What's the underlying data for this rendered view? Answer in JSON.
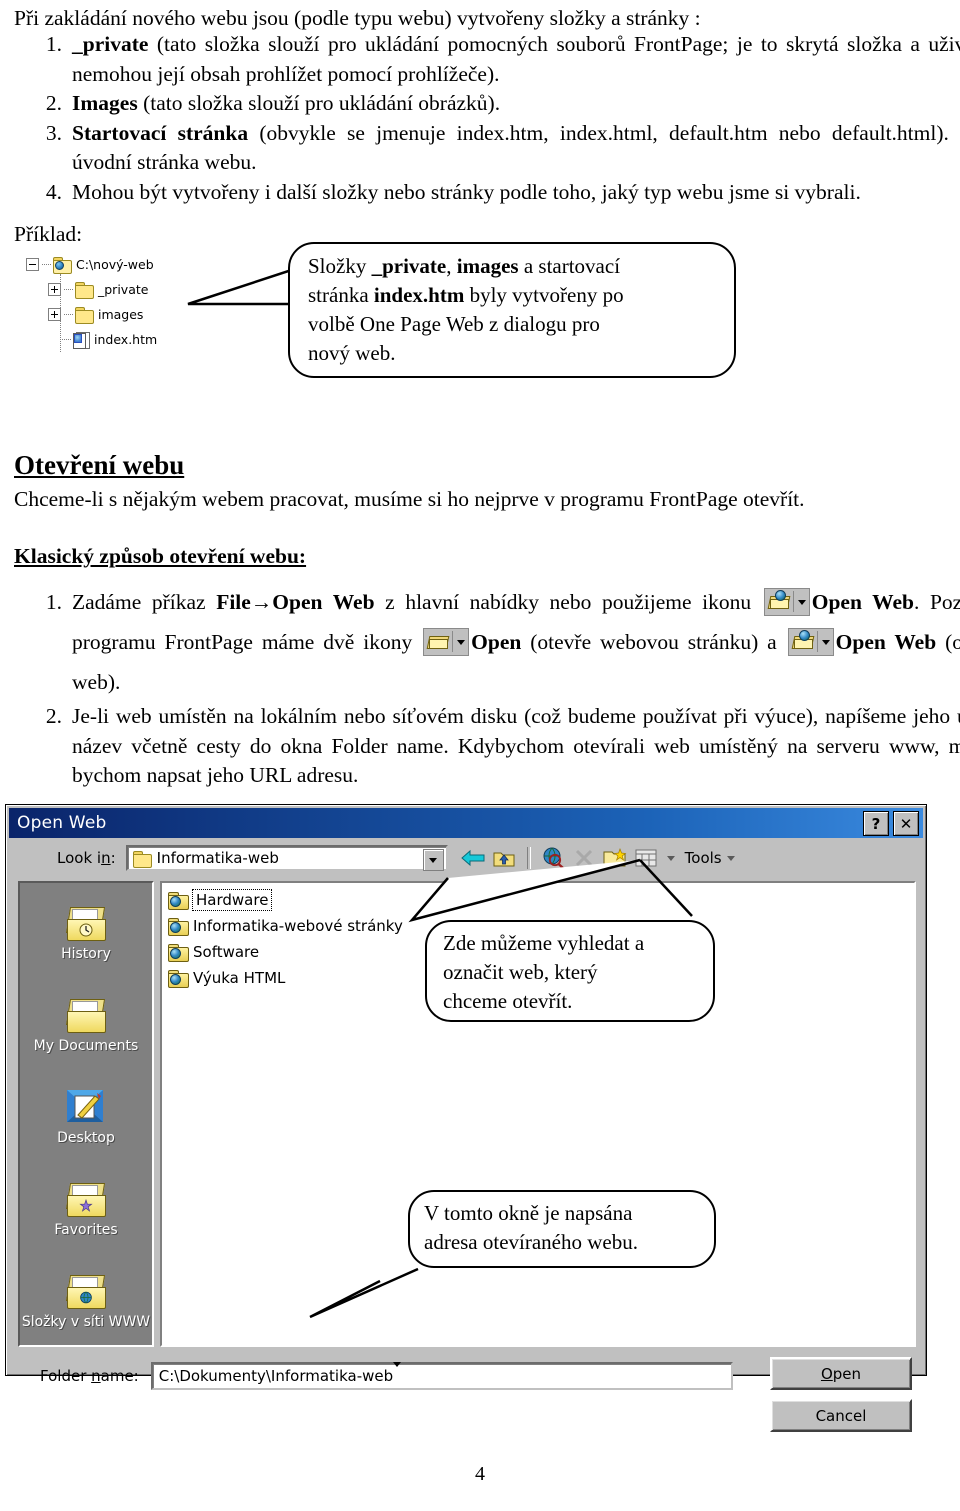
{
  "document": {
    "intro": "Při zakládání nového webu jsou (podle typu webu) vytvořeny složky a stránky :",
    "list": [
      {
        "num": "1.",
        "bold": "_private",
        "rest": " (tato složka slouží pro ukládání pomocných souborů FrontPage; je to skrytá složka a uživatelé nemohou její obsah prohlížet pomocí prohlížeče)."
      },
      {
        "num": "2.",
        "bold": "Images",
        "rest": " (tato složka slouží pro ukládání obrázků)."
      },
      {
        "num": "3.",
        "bold": "Startovací stránka",
        "rest": " (obvykle se jmenuje index.htm, index.html, default.htm nebo default.html). Je to úvodní stránka webu."
      },
      {
        "num": "4.",
        "bold": "",
        "rest": "Mohou být vytvořeny i další složky nebo stránky podle toho, jaký typ webu jsme si vybrali."
      }
    ],
    "priklad_label": "Příklad:"
  },
  "tree": {
    "root": "C:\\nový-web",
    "children": [
      {
        "label": "_private",
        "type": "folder"
      },
      {
        "label": "images",
        "type": "folder"
      },
      {
        "label": "index.htm",
        "type": "htmlfile"
      }
    ]
  },
  "bubble_tree": {
    "line1_a": "Složky ",
    "line1_b1": "_private",
    "line1_c": ", ",
    "line1_b2": "images",
    "line1_d": " a startovací",
    "line2_a": "stránka ",
    "line2_b": "index.htm",
    "line2_c": " byly vytvořeny po",
    "line3": "volbě One Page Web z dialogu pro",
    "line4": "nový web."
  },
  "section_open": {
    "heading": "Otevření webu",
    "paragraph": "Chceme-li s nějakým webem pracovat, musíme si ho nejprve v programu FrontPage otevřít.",
    "subheading": "Klasický způsob otevření webu:",
    "item1": {
      "num": "1.",
      "t1": "Zadáme příkaz ",
      "b1": "File→Open Web",
      "t2": " z hlavní nabídky nebo použijeme ikonu ",
      "b2": "Open Web",
      "t3": ". Pozor, v programu FrontPage máme dvě ikony ",
      "b3": "Open",
      "t4": " (otevře webovou stránku) a ",
      "b4": "Open Web",
      "t5": " (otevře web)."
    },
    "item2": {
      "num": "2.",
      "text": "Je-li web umístěn na lokálním nebo síťovém disku (což budeme používat při výuce), napíšeme jeho úplný název včetně cesty do okna Folder name. Kdybychom otevírali web umístěný na serveru www, museli bychom napsat jeho URL adresu."
    }
  },
  "dialog": {
    "title": "Open Web",
    "titlebar_buttons": [
      {
        "name": "help-button",
        "glyph": "?"
      },
      {
        "name": "close-button",
        "glyph": "✕"
      }
    ],
    "lookin_label_pre": "Look i",
    "lookin_label_accel": "n",
    "lookin_label_post": ":",
    "lookin_value": "Informatika-web",
    "toolbar": [
      {
        "name": "back-icon",
        "label": "Back"
      },
      {
        "name": "up-one-level-icon",
        "label": "Up One Level"
      },
      {
        "name": "search-web-icon",
        "label": "Search the Web"
      },
      {
        "name": "delete-icon",
        "label": "Delete"
      },
      {
        "name": "new-folder-icon",
        "label": "Create New Folder"
      },
      {
        "name": "views-icon",
        "label": "Views"
      }
    ],
    "tools_label": "Tools",
    "places": [
      {
        "label": "History",
        "icon": "history-folder-icon"
      },
      {
        "label": "My Documents",
        "icon": "my-documents-folder-icon"
      },
      {
        "label": "Desktop",
        "icon": "desktop-icon"
      },
      {
        "label": "Favorites",
        "icon": "favorites-folder-icon"
      },
      {
        "label": "Složky v síti WWW",
        "icon": "web-folders-icon"
      }
    ],
    "files": [
      {
        "label": "Hardware",
        "selected": true
      },
      {
        "label": "Informatika-webové stránky",
        "selected": false
      },
      {
        "label": "Software",
        "selected": false
      },
      {
        "label": "Výuka HTML",
        "selected": false
      }
    ],
    "foldername_label_pre": "Folder ",
    "foldername_label_accel": "n",
    "foldername_label_post": "ame:",
    "foldername_value": "C:\\Dokumenty\\Informatika-web",
    "open_button_pre": "",
    "open_button_accel": "O",
    "open_button_post": "pen",
    "cancel_button": "Cancel"
  },
  "bubble_select": {
    "line1": "Zde můžeme vyhledat a",
    "line2": "označit web, který",
    "line3": "chceme otevřít."
  },
  "bubble_address": {
    "line1": "V tomto okně je napsána",
    "line2": "adresa otevíraného webu."
  },
  "footer": {
    "page_number": "4"
  },
  "colors": {
    "title_bar": "#0a246a",
    "dialog_face": "#c0c0c0",
    "places_bar": "#808080",
    "folder_yellow": "#ffe88a"
  }
}
